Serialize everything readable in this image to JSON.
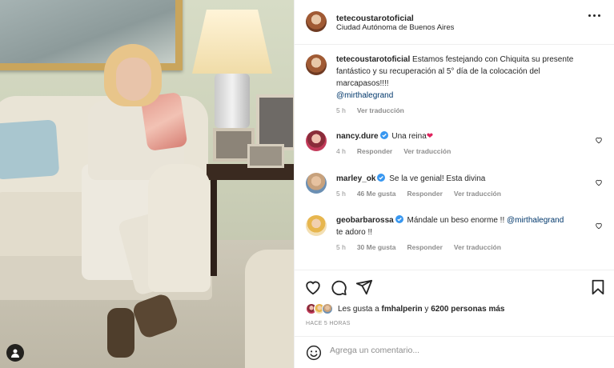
{
  "post": {
    "author": "tetecoustarotoficial",
    "location": "Ciudad Autónoma de Buenos Aires"
  },
  "caption": {
    "username": "tetecoustarotoficial",
    "text": "Estamos festejando con Chiquita su presente fantástico y su recuperación al 5° día de la colocación del marcapasos!!!!",
    "mention": "@mirthalegrand",
    "time": "5 h",
    "translate": "Ver traducción"
  },
  "comments": [
    {
      "username": "nancy.dure",
      "text": "Una reina",
      "emoji": "❤",
      "time": "4 h",
      "likes": "",
      "reply": "Responder",
      "translate": "Ver traducción"
    },
    {
      "username": "marley_ok",
      "text": "Se la ve genial! Esta divina",
      "time": "5 h",
      "likes": "46 Me gusta",
      "reply": "Responder",
      "translate": "Ver traducción"
    },
    {
      "username": "geobarbarossa",
      "text": "Mándale un beso enorme !!",
      "mention": "@mirthalegrand",
      "text2": "te adoro !!",
      "time": "5 h",
      "likes": "30 Me gusta",
      "reply": "Responder",
      "translate": "Ver traducción"
    }
  ],
  "likes": {
    "prefix": "Les gusta a",
    "user": "fmhalperin",
    "middle": "y",
    "count": "6200 personas más"
  },
  "time_ago": "HACE 5 HORAS",
  "add_comment": {
    "placeholder": "Agrega un comentario..."
  },
  "icons": [
    "heart-icon",
    "comment-icon",
    "share-icon",
    "bookmark-icon",
    "emoji-icon",
    "more-icon",
    "verified-icon",
    "user-tag-icon"
  ],
  "colors": {
    "verified": "#3897f0",
    "mention": "#00376b",
    "meta": "#8e8e8e",
    "heart_red": "#e0245e"
  }
}
